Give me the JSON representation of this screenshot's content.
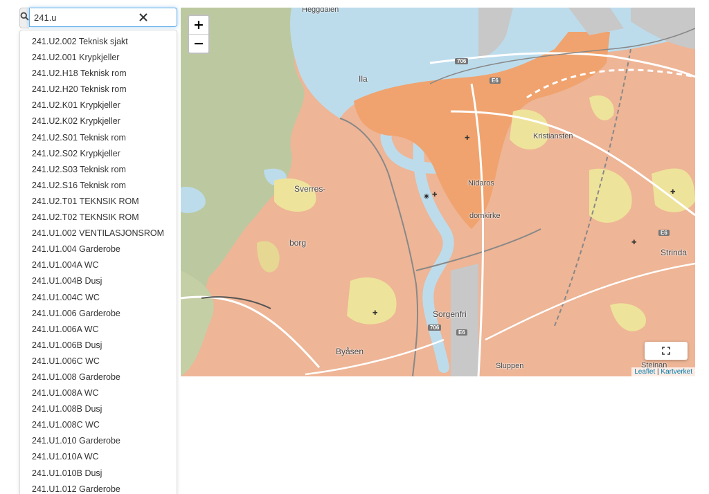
{
  "search": {
    "value": "241.u",
    "placeholder": ""
  },
  "dropdown": {
    "items": [
      "241.U2.002 Teknisk sjakt",
      "241.U2.001 Krypkjeller",
      "241.U2.H18 Teknisk rom",
      "241.U2.H20 Teknisk rom",
      "241.U2.K01 Krypkjeller",
      "241.U2.K02 Krypkjeller",
      "241.U2.S01 Teknisk rom",
      "241.U2.S02 Krypkjeller",
      "241.U2.S03 Teknisk rom",
      "241.U2.S16 Teknisk rom",
      "241.U2.T01 TEKNSIK ROM",
      "241.U2.T02 TEKNSIK ROM",
      "241.U1.002 VENTILASJONSROM",
      "241.U1.004 Garderobe",
      "241.U1.004A WC",
      "241.U1.004B Dusj",
      "241.U1.004C WC",
      "241.U1.006 Garderobe",
      "241.U1.006A WC",
      "241.U1.006B Dusj",
      "241.U1.006C WC",
      "241.U1.008 Garderobe",
      "241.U1.008A WC",
      "241.U1.008B Dusj",
      "241.U1.008C WC",
      "241.U1.010 Garderobe",
      "241.U1.010A WC",
      "241.U1.010B Dusj",
      "241.U1.012 Garderobe"
    ]
  },
  "map": {
    "zoom_in": "+",
    "zoom_out": "−",
    "places": {
      "heggdalen": "Heggdalen",
      "ila": "Ila",
      "kristiansten": "Kristiansten",
      "sverres": "Sverres-",
      "borg": "borg",
      "nidaros": "Nidaros",
      "domkirke": "domkirke",
      "strinda": "Strinda",
      "sorgenfri": "Sorgenfri",
      "byasen": "Byåsen",
      "sluppen": "Sluppen",
      "steinan": "Steinan"
    },
    "roads": {
      "r706a": "706",
      "e6a": "E6",
      "e6b": "E6",
      "r706b": "706",
      "e6c": "E6"
    },
    "attribution": {
      "leaflet": "Leaflet",
      "separator": " | ",
      "kartverket": "Kartverket"
    }
  },
  "colors": {
    "water": "#bcdcec",
    "land_urban": "#eeb596",
    "land_center": "#f0a36e",
    "forest": "#bcc9a0",
    "park": "#eee39a",
    "industrial": "#c8c8c8",
    "input_focus": "#66afe9"
  }
}
